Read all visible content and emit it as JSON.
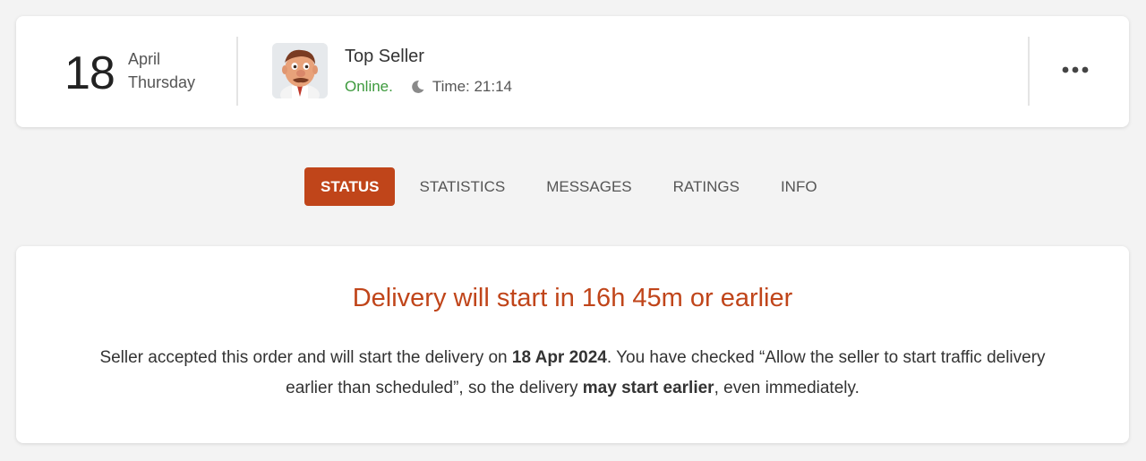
{
  "header": {
    "date_number": "18",
    "month": "April",
    "weekday": "Thursday",
    "seller": {
      "name": "Top Seller",
      "status": "Online.",
      "time": "Time: 21:14"
    },
    "more_icon": "more-horizontal-icon"
  },
  "tabs": [
    {
      "label": "STATUS",
      "active": true
    },
    {
      "label": "STATISTICS",
      "active": false
    },
    {
      "label": "MESSAGES",
      "active": false
    },
    {
      "label": "RATINGS",
      "active": false
    },
    {
      "label": "INFO",
      "active": false
    }
  ],
  "status_panel": {
    "headline": "Delivery will start in 16h 45m or earlier",
    "p1": "Seller accepted this order and will start the delivery on ",
    "p1_bold": "18 Apr 2024",
    "p2": ". You have checked “Allow the seller to start traffic delivery earlier than scheduled”, so the delivery ",
    "p2_bold": "may start earlier",
    "p3": ", even immediately."
  },
  "colors": {
    "accent": "#c0451a",
    "online": "#3d9a3d",
    "background": "#f3f3f3"
  }
}
